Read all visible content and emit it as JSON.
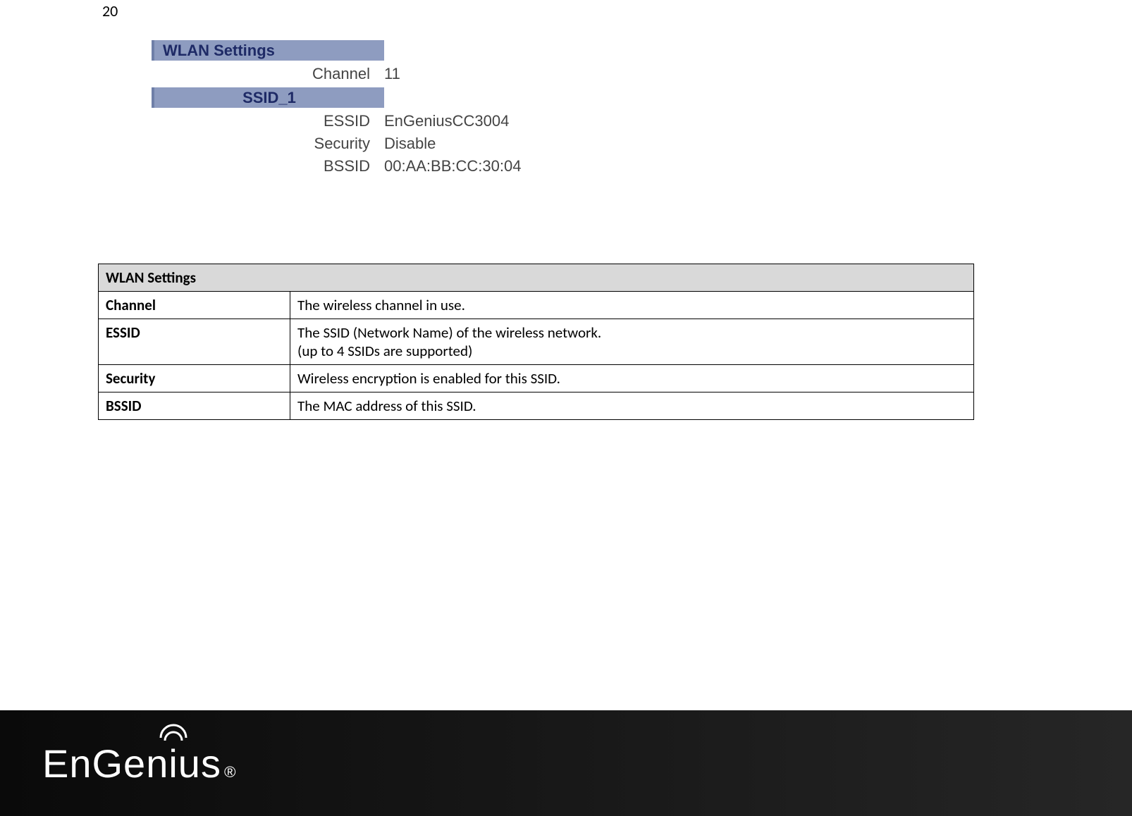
{
  "page_number": "20",
  "wlan_box": {
    "section_wlan": "WLAN Settings",
    "channel_label": "Channel",
    "channel_value": "11",
    "section_ssid1": "SSID_1",
    "essid_label": "ESSID",
    "essid_value": "EnGeniusCC3004",
    "security_label": "Security",
    "security_value": "Disable",
    "bssid_label": "BSSID",
    "bssid_value": "00:AA:BB:CC:30:04"
  },
  "desc_table": {
    "header": "WLAN Settings",
    "rows": [
      {
        "name": "Channel",
        "desc": "The wireless channel in use."
      },
      {
        "name": "ESSID",
        "desc": "The SSID (Network Name) of the wireless network.\n(up to 4 SSIDs are supported)"
      },
      {
        "name": "Security",
        "desc": "Wireless encryption is enabled for this SSID."
      },
      {
        "name": "BSSID",
        "desc": "The MAC address of this SSID."
      }
    ]
  },
  "footer": {
    "brand": "EnGenius",
    "reg": "®"
  }
}
